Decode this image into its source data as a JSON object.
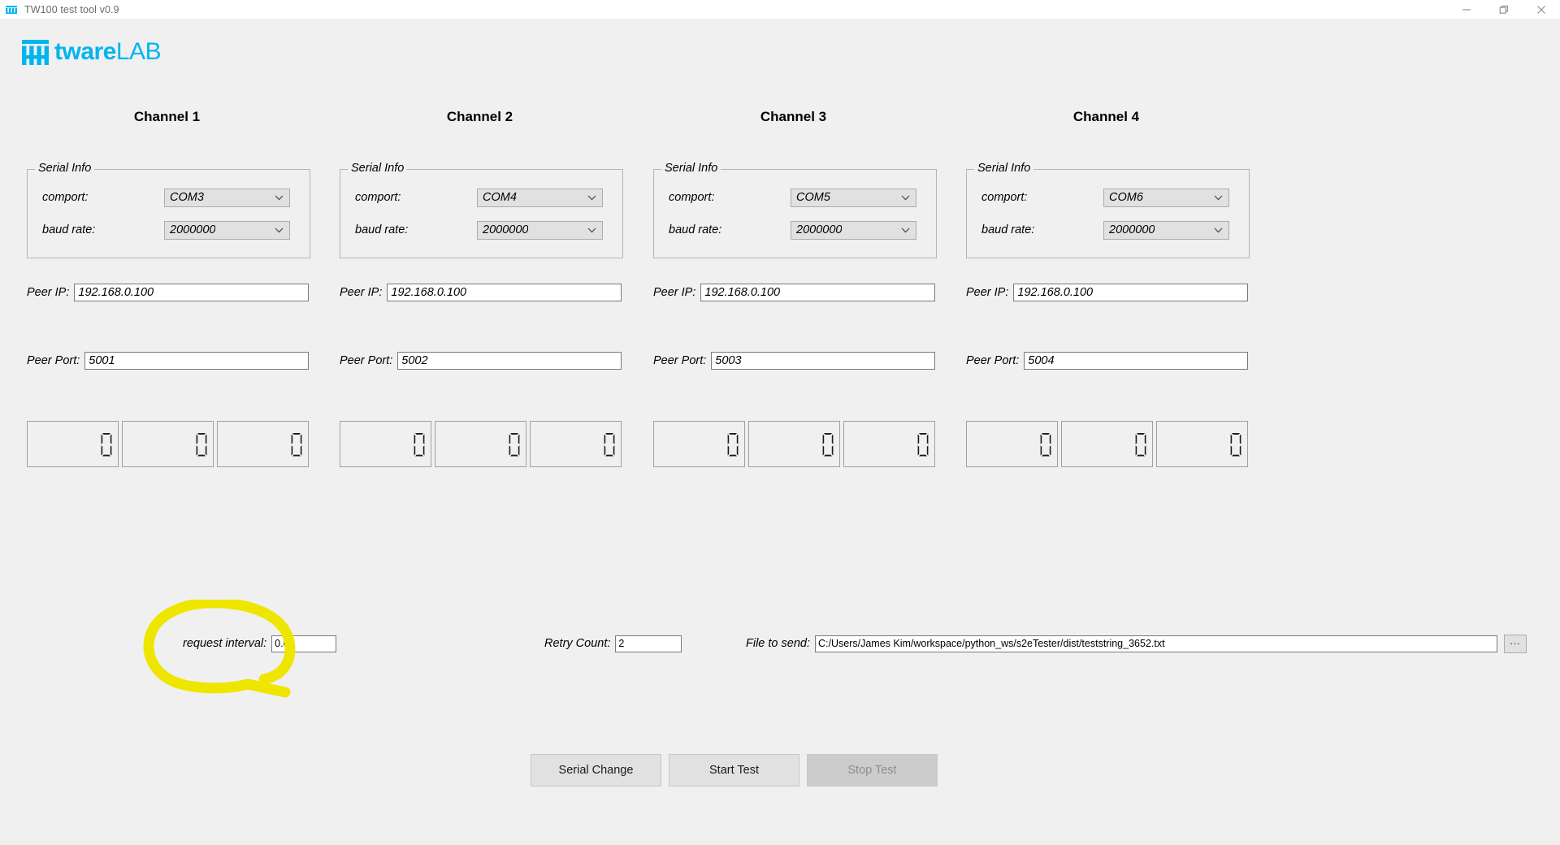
{
  "window": {
    "title": "TW100 test tool v0.9",
    "app_icon": "twarelab-icon",
    "controls": {
      "minimize": "minimize-icon",
      "maximize": "maximize-icon",
      "close": "close-icon"
    }
  },
  "brand": {
    "mark": "twarelab-logo-mark",
    "bold_part": "tware",
    "light_part": "LAB",
    "color": "#00b5ef"
  },
  "groupbox_label": "Serial Info",
  "labels": {
    "comport": "comport:",
    "baud_rate": "baud rate:",
    "peer_ip": "Peer IP:",
    "peer_port": "Peer Port:",
    "request_interval": "request interval:",
    "retry_count": "Retry Count:",
    "file_to_send": "File to send:"
  },
  "channels": [
    {
      "title": "Channel 1",
      "comport": "COM3",
      "baud_rate": "2000000",
      "peer_ip": "192.168.0.100",
      "peer_port": "5001",
      "counters": [
        "0",
        "0",
        "0"
      ]
    },
    {
      "title": "Channel 2",
      "comport": "COM4",
      "baud_rate": "2000000",
      "peer_ip": "192.168.0.100",
      "peer_port": "5002",
      "counters": [
        "0",
        "0",
        "0"
      ]
    },
    {
      "title": "Channel 3",
      "comport": "COM5",
      "baud_rate": "2000000",
      "peer_ip": "192.168.0.100",
      "peer_port": "5003",
      "counters": [
        "0",
        "0",
        "0"
      ]
    },
    {
      "title": "Channel 4",
      "comport": "COM6",
      "baud_rate": "2000000",
      "peer_ip": "192.168.0.100",
      "peer_port": "5004",
      "counters": [
        "0",
        "0",
        "0"
      ]
    }
  ],
  "bottom": {
    "request_interval_value": "0.0",
    "retry_count_value": "2",
    "file_to_send_value": "C:/Users/James Kim/workspace/python_ws/s2eTester/dist/teststring_3652.txt",
    "browse_label": "...",
    "browse_icon": "ellipsis-icon"
  },
  "actions": {
    "serial_change": "Serial Change",
    "start_test": "Start Test",
    "stop_test": "Stop Test",
    "stop_test_disabled": true
  },
  "annotation": {
    "shape": "hand-drawn-ellipse",
    "color": "#efe600",
    "target": "request interval:"
  }
}
